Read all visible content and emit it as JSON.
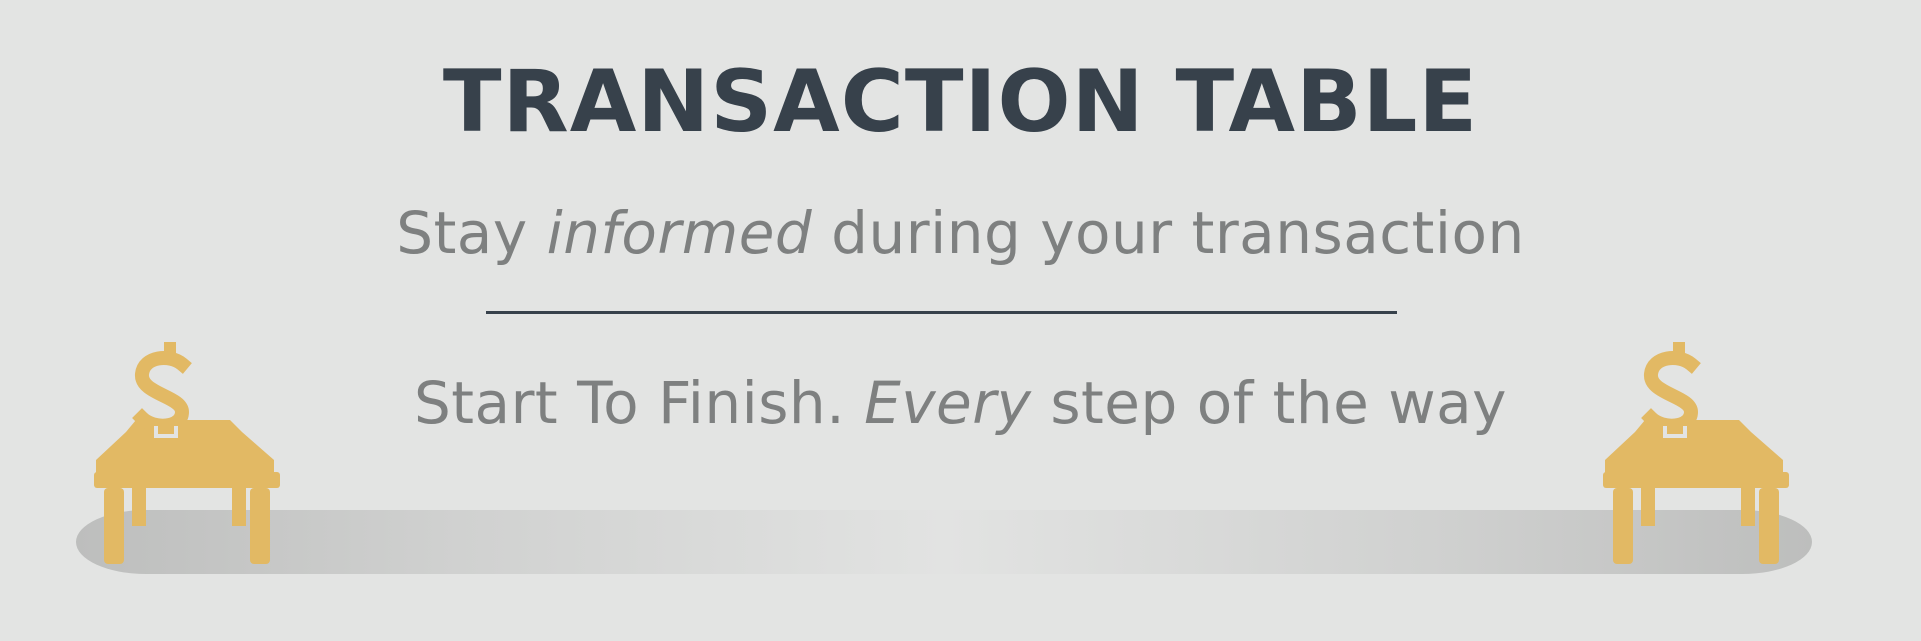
{
  "banner": {
    "title": "TRANSACTION TABLE",
    "subtitle": {
      "before": "Stay ",
      "emphasis": "informed",
      "after": " during your transaction"
    },
    "tagline": {
      "before": "Start To Finish. ",
      "emphasis": "Every",
      "after": " step of the way"
    }
  },
  "icons": {
    "left": "money-table-icon",
    "right": "money-table-icon",
    "color": "#e2b964"
  },
  "colors": {
    "background": "#e3e4e3",
    "title": "#37414b",
    "text": "#7e8080",
    "accent": "#e2b964"
  }
}
